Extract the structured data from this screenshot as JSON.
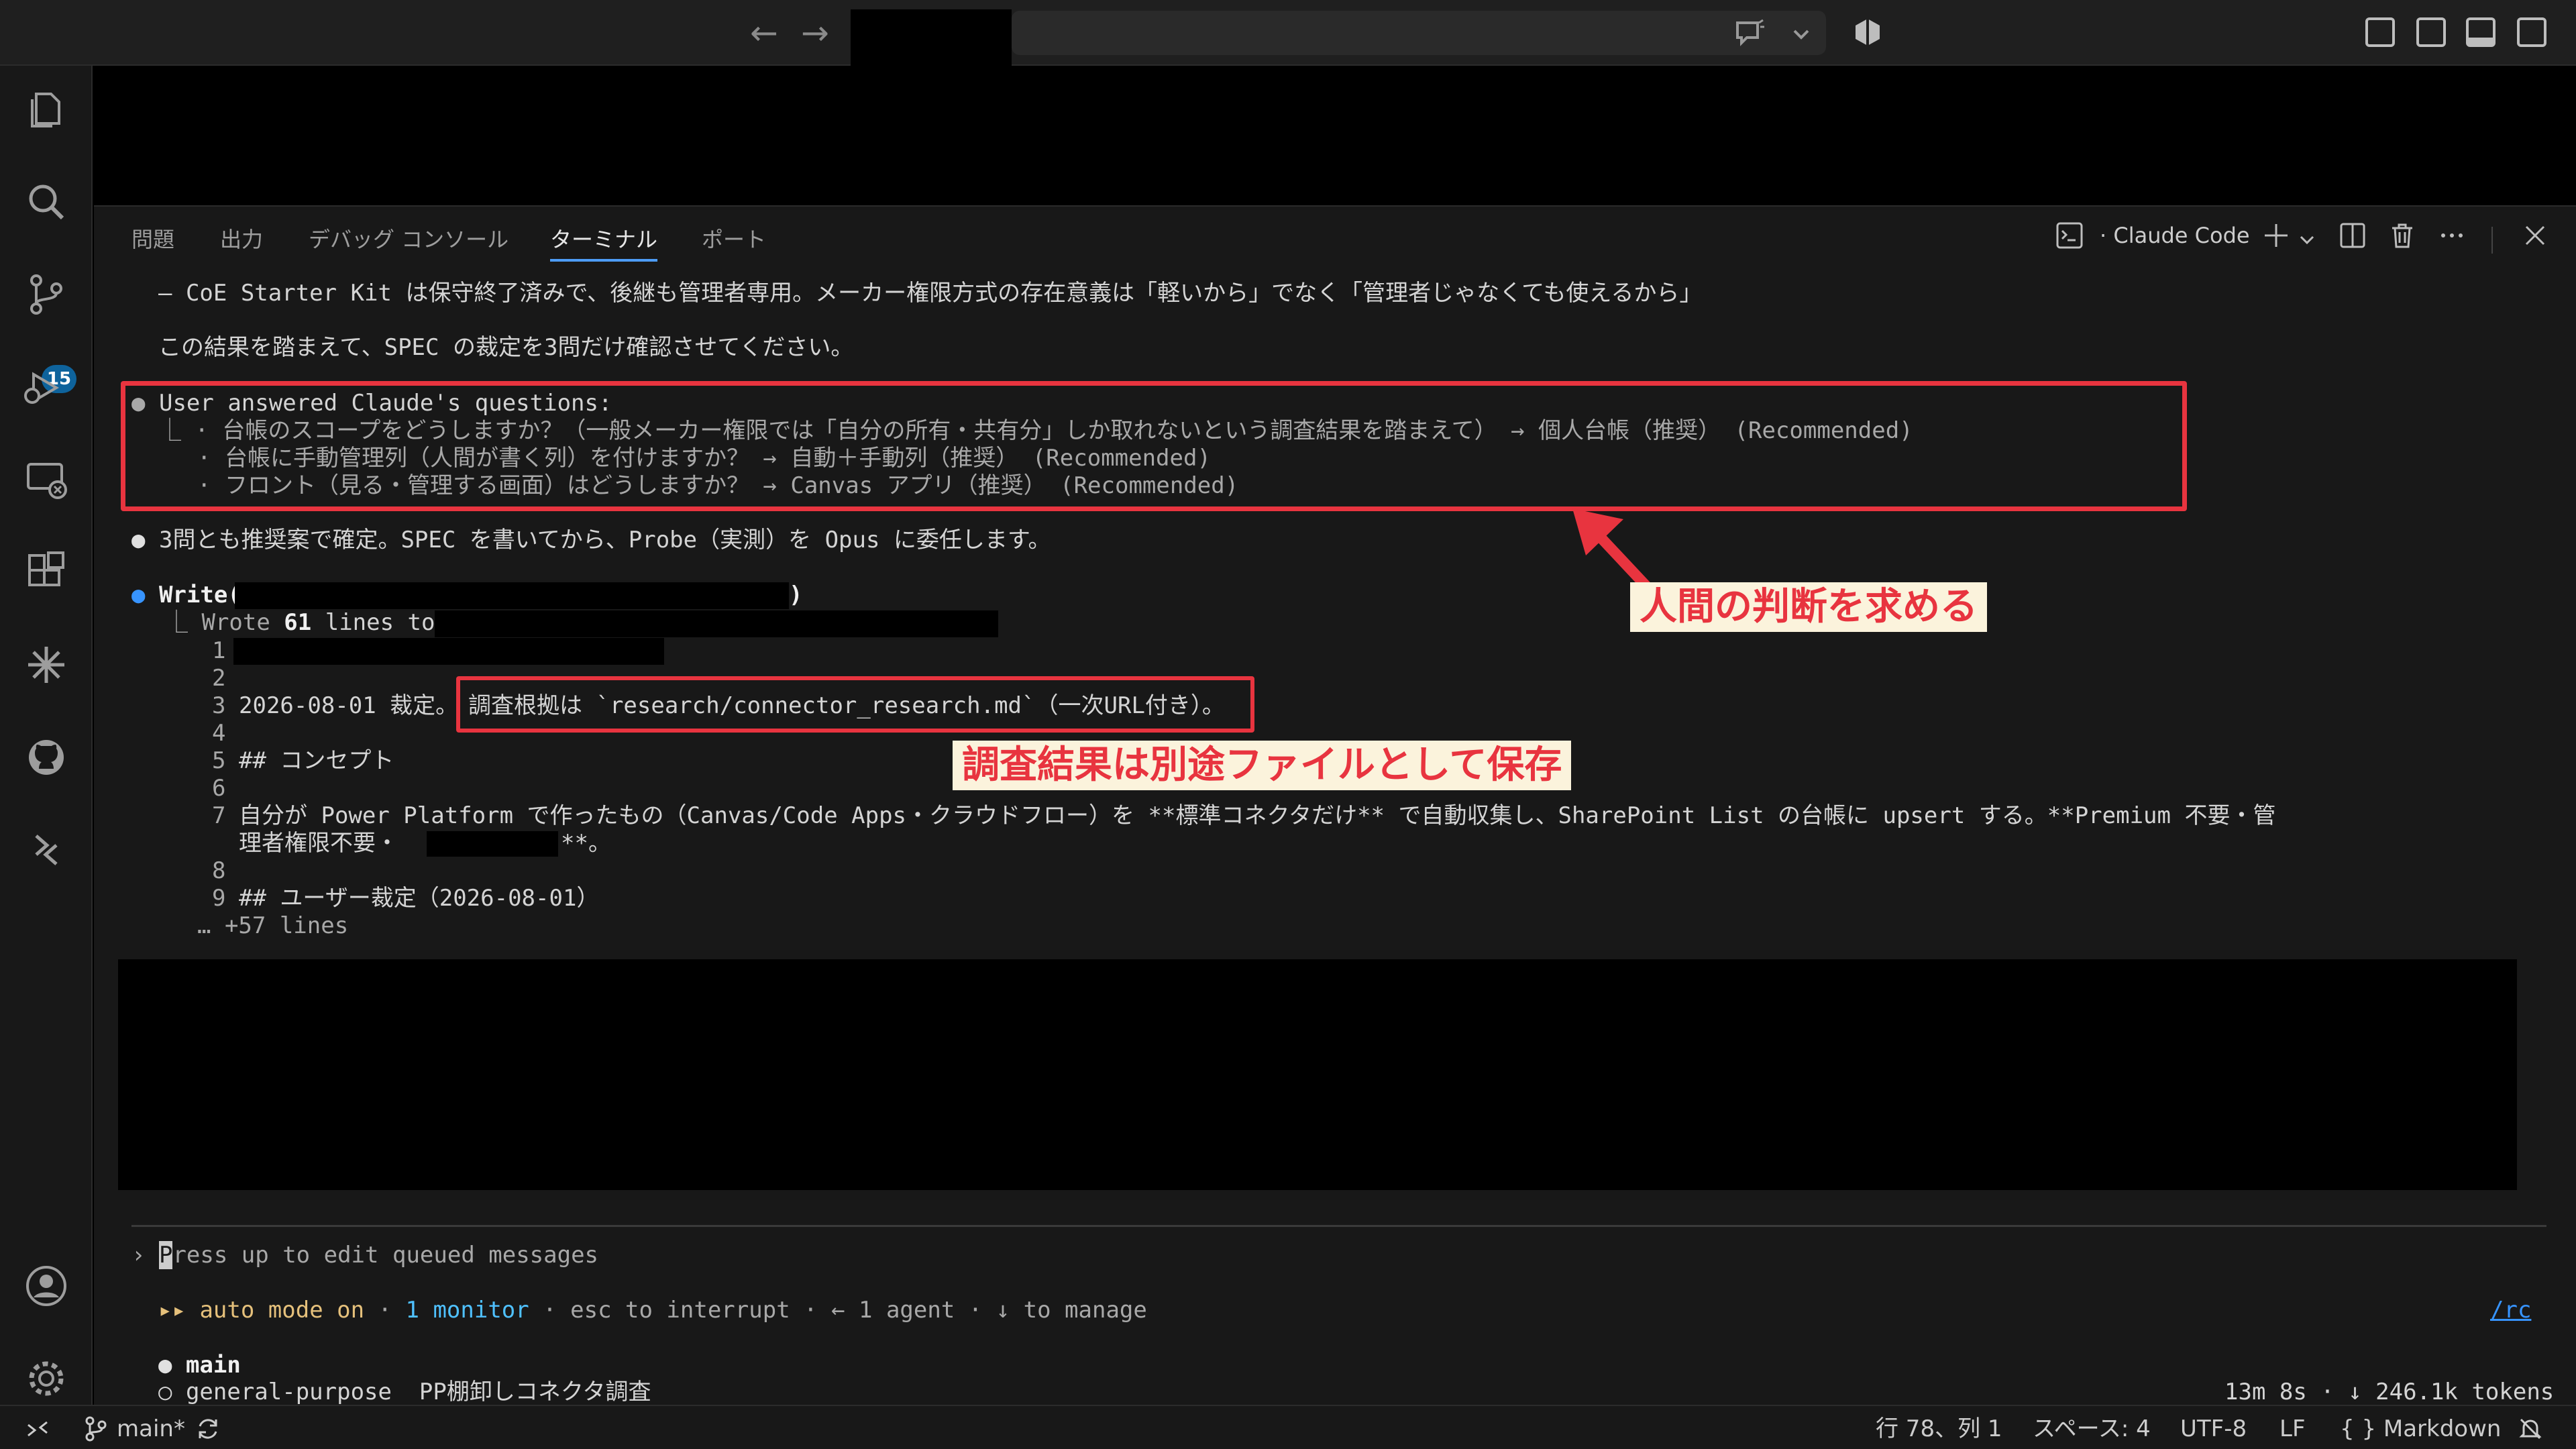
{
  "titlebar": {
    "back": "←",
    "forward": "→"
  },
  "activity": {
    "badge": "15"
  },
  "panel": {
    "tabs": [
      {
        "label": "問題"
      },
      {
        "label": "出力"
      },
      {
        "label": "デバッグ コンソール"
      },
      {
        "label": "ターミナル"
      },
      {
        "label": "ポート"
      }
    ],
    "terminal_name": "· Claude Code"
  },
  "terminal": {
    "line1": "– CoE Starter Kit は保守終了済みで、後継も管理者専用。メーカー権限方式の存在意義は「軽いから」でなく「管理者じゃなくても使えるから」",
    "line2": "この結果を踏まえて、SPEC の裁定を3問だけ確認させてください。",
    "answered_header": "User answered Claude's questions:",
    "q1": "⎿ · 台帳のスコープをどうしますか？（一般メーカー権限では「自分の所有・共有分」しか取れないという調査結果を踏まえて） → 個人台帳（推奨） (Recommended)",
    "q2": "· 台帳に手動管理列（人間が書く列）を付けますか？ → 自動＋手動列（推奨） (Recommended)",
    "q3": "· フロント（見る・管理する画面）はどうしますか？ → Canvas アプリ（推奨） (Recommended)",
    "confirm": "3問とも推奨案で確定。SPEC を書いてから、Probe（実測）を Opus に委任します。",
    "write_label": "Write(",
    "write_close": ")",
    "wrote_prefix": "⎿ Wrote ",
    "wrote_count": "61",
    "wrote_suffix": " lines to",
    "n1": "1",
    "n2": "2",
    "n3": "3",
    "l3a": "2026-08-01 裁定。",
    "l3b": "調査根拠は `research/connector_research.md`（一次URL付き）。",
    "n4": "4",
    "n5": "5",
    "l5": "## コンセプト",
    "n6": "6",
    "n7": "7",
    "l7": "自分が Power Platform で作ったもの（Canvas/Code Apps・クラウドフロー）を **標準コネクタだけ** で自動収集し、SharePoint List の台帳に upsert する。**Premium 不要・管",
    "l7b1": "理者権限不要・",
    "l7b2": "**。",
    "n8": "8",
    "n9": "9",
    "l9": "## ユーザー裁定（2026-08-01）",
    "more": "… +57 lines",
    "prompt_mark": "›",
    "prompt_first": "P",
    "prompt_rest": "ress up to edit queued messages",
    "mode_arrows": "▸▸",
    "mode_label": "auto mode on",
    "sep1": " · ",
    "monitor": "1 monitor",
    "status_rest": " · esc to interrupt · ← 1 agent · ↓ to manage",
    "rc": "/rc",
    "branch_main": "main",
    "agent_line": "○ general-purpose  PP棚卸しコネクタ調査",
    "elapsed": "13m 8s · ↓ 246.1k tokens"
  },
  "annotations": {
    "human_judgment": "人間の判断を求める",
    "saved_separately": "調査結果は別途ファイルとして保存"
  },
  "statusbar": {
    "branch": "main*",
    "position": "行 78、列 1",
    "spaces": "スペース: 4",
    "encoding": "UTF-8",
    "eol": "LF",
    "language": "{ } Markdown"
  },
  "colors": {
    "annotation_red": "#e8343f",
    "annotation_bg": "#fbf3dc",
    "accent_blue": "#3794ff",
    "auto_mode_yellow": "#e5c07b"
  }
}
